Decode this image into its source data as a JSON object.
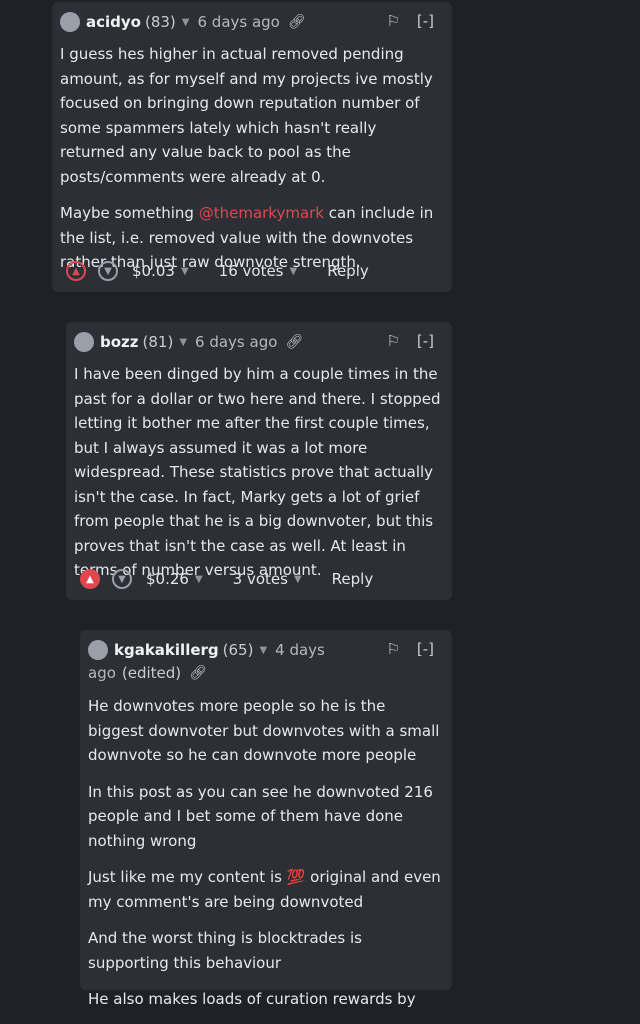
{
  "comments": [
    {
      "author": "acidyo",
      "reputation": "(83)",
      "timestamp": "6 days ago",
      "edited": "",
      "collapse_label": "[-]",
      "paragraphs": [
        "I guess hes higher in actual removed pending amount, as for myself and my projects ive mostly focused on bringing down reputation number of some spammers lately which hasn't really returned any value back to pool as the posts/comments were already at 0."
      ],
      "p2_before": "Maybe something ",
      "p2_mention": "@themarkymark",
      "p2_after": " can include in the list, i.e. removed value with the downvotes rather than just raw downvote strength.",
      "payout": "$0.03",
      "votes": "16 votes",
      "reply": "Reply"
    },
    {
      "author": "bozz",
      "reputation": "(81)",
      "timestamp": "6 days ago",
      "collapse_label": "[-]",
      "paragraphs": [
        "I have been dinged by him a couple times in the past for a dollar or two here and there. I stopped letting it bother me after the first couple times, but I always assumed it was a lot more widespread. These statistics prove that actually isn't the case. In fact, Marky gets a lot of grief from people that he is a big downvoter, but this proves that isn't the case as well. At least in terms of number versus amount."
      ],
      "payout": "$0.26",
      "votes": "3 votes",
      "reply": "Reply"
    },
    {
      "author": "kgakakillerg",
      "reputation": "(65)",
      "timestamp_line1": "4 days",
      "timestamp_line2": "ago",
      "edited": "(edited)",
      "collapse_label": "[-]",
      "paragraphs": [
        "He downvotes more people so he is the biggest downvoter but downvotes with a small downvote so he can downvote more people",
        "In this post as you can see he downvoted 216 people and I bet some of them have done nothing wrong",
        "Just like me my content is 💯 original and even my comment's are being downvoted",
        "And the worst thing is blocktrades is supporting this behaviour",
        "He also makes loads of curation rewards by"
      ]
    }
  ]
}
